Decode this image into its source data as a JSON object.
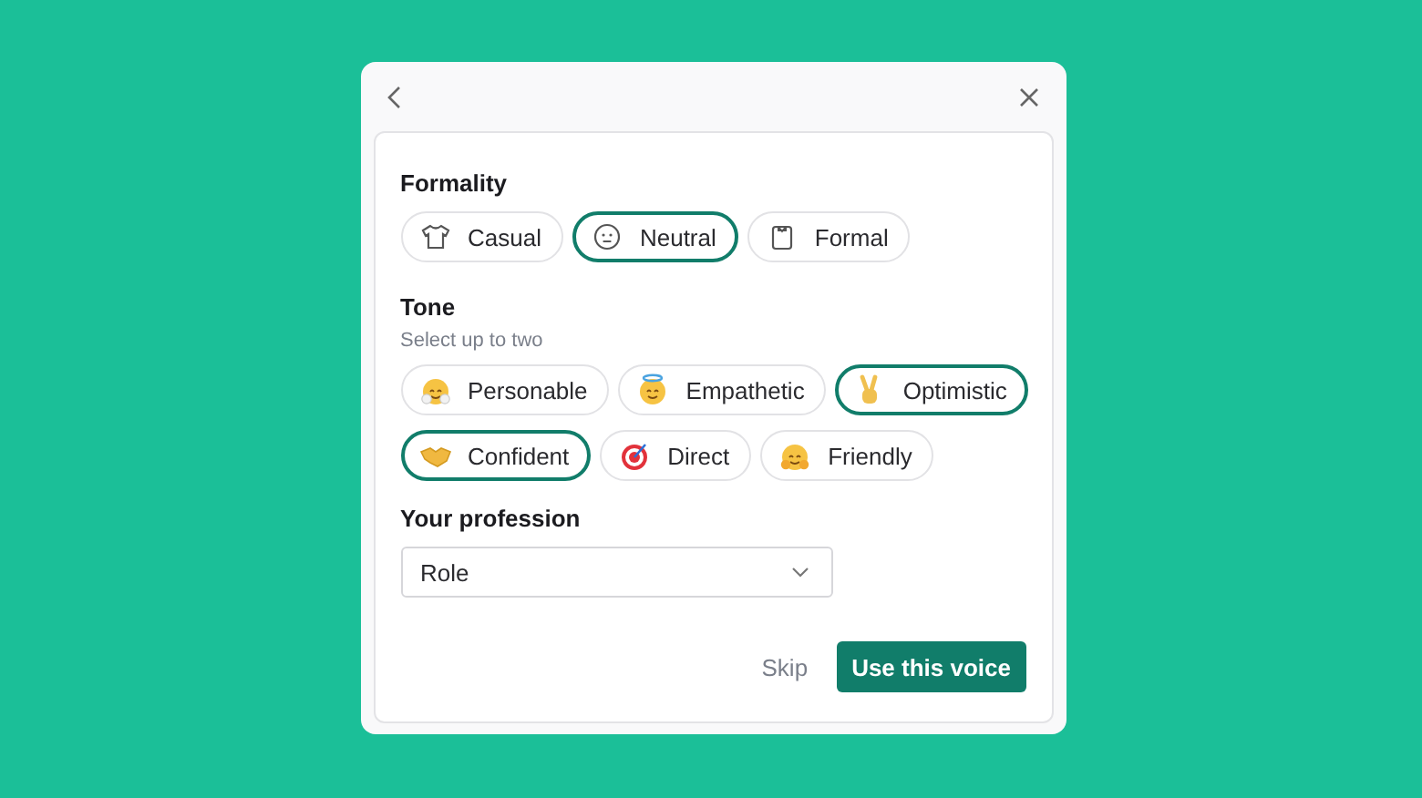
{
  "sections": [
    {
      "title": "Formality",
      "options": [
        {
          "label": "Casual",
          "selected": false
        },
        {
          "label": "Neutral",
          "selected": true
        },
        {
          "label": "Formal",
          "selected": false
        }
      ]
    },
    {
      "title": "Tone",
      "subtitle": "Select up to two",
      "options": [
        {
          "label": "Personable",
          "selected": false
        },
        {
          "label": "Empathetic",
          "selected": false
        },
        {
          "label": "Optimistic",
          "selected": true
        },
        {
          "label": "Confident",
          "selected": true
        },
        {
          "label": "Direct",
          "selected": false
        },
        {
          "label": "Friendly",
          "selected": false
        }
      ]
    }
  ],
  "profession": {
    "label": "Your profession",
    "placeholder": "Role"
  },
  "buttons": {
    "skip": "Skip",
    "primary": "Use this voice"
  }
}
